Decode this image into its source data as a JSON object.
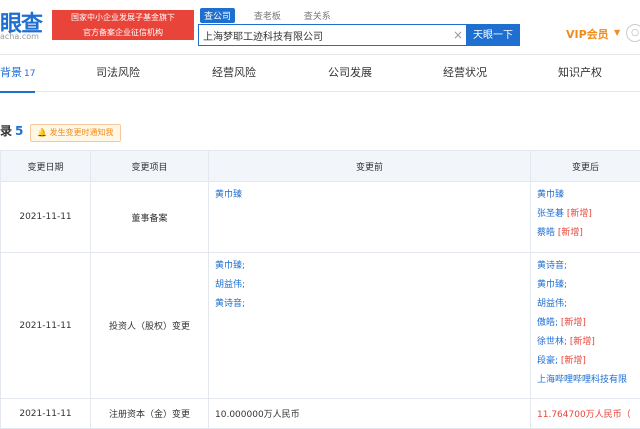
{
  "header": {
    "logo": "眼查",
    "logo_sub": "acha.com",
    "banner_line1": "国家中小企业发展子基金旗下",
    "banner_line2": "官方备案企业征信机构",
    "search_tabs": [
      "查公司",
      "查老板",
      "查关系"
    ],
    "search_value": "上海梦耶工迹科技有限公司",
    "search_button": "天眼一下",
    "vip": "VIP会员"
  },
  "nav": {
    "items": [
      {
        "label": "背景",
        "count": "17"
      },
      {
        "label": "司法风险"
      },
      {
        "label": "经营风险"
      },
      {
        "label": "公司发展"
      },
      {
        "label": "经营状况"
      },
      {
        "label": "知识产权"
      }
    ]
  },
  "section": {
    "title": "录",
    "count": "5",
    "notify": "发生变更时通知我"
  },
  "table": {
    "headers": [
      "变更日期",
      "变更项目",
      "变更前",
      "变更后"
    ],
    "rows": [
      {
        "date": "2021-11-11",
        "item": "董事备案",
        "before": [
          {
            "name": "黄巾臻",
            "tag": ""
          }
        ],
        "after": [
          {
            "name": "黄巾臻",
            "tag": ""
          },
          {
            "name": "张圣碁",
            "tag": "[新增]"
          },
          {
            "name": "蔡皓",
            "tag": "[新增]"
          }
        ]
      },
      {
        "date": "2021-11-11",
        "item": "投资人（股权）变更",
        "before": [
          {
            "name": "黄巾臻;",
            "tag": ""
          },
          {
            "name": "胡益伟;",
            "tag": ""
          },
          {
            "name": "黄诗音;",
            "tag": ""
          }
        ],
        "after": [
          {
            "name": "黄诗音;",
            "tag": ""
          },
          {
            "name": "黄巾臻;",
            "tag": ""
          },
          {
            "name": "胡益伟;",
            "tag": ""
          },
          {
            "name": "傲皓;",
            "tag": "[新增]"
          },
          {
            "name": "徐世林;",
            "tag": "[新增]"
          },
          {
            "name": "段豪;",
            "tag": "[新增]"
          },
          {
            "name": "上海哔哩哔哩科技有限",
            "tag": ""
          }
        ]
      },
      {
        "date": "2021-11-11",
        "item": "注册资本（金）变更",
        "before_text": "10.000000万人民币",
        "after_text": "11.764700万人民币（"
      }
    ]
  }
}
